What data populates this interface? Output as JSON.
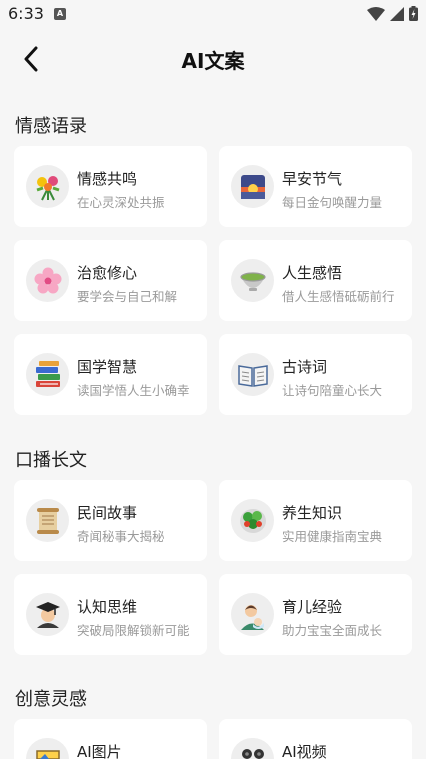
{
  "status": {
    "time": "6:33"
  },
  "header": {
    "title": "AI文案"
  },
  "sections": [
    {
      "title": "情感语录",
      "cards": [
        {
          "title": "情感共鸣",
          "subtitle": "在心灵深处共振",
          "icon": "flower-bouquet-icon"
        },
        {
          "title": "早安节气",
          "subtitle": "每日金句唤醒力量",
          "icon": "sunrise-icon"
        },
        {
          "title": "治愈修心",
          "subtitle": "要学会与自己和解",
          "icon": "cherry-blossom-icon"
        },
        {
          "title": "人生感悟",
          "subtitle": "借人生感悟砥砺前行",
          "icon": "tea-bowl-icon"
        },
        {
          "title": "国学智慧",
          "subtitle": "读国学悟人生小确幸",
          "icon": "books-icon"
        },
        {
          "title": "古诗词",
          "subtitle": "让诗句陪童心长大",
          "icon": "open-book-icon"
        }
      ]
    },
    {
      "title": "口播长文",
      "cards": [
        {
          "title": "民间故事",
          "subtitle": "奇闻秘事大揭秘",
          "icon": "scroll-icon"
        },
        {
          "title": "养生知识",
          "subtitle": "实用健康指南宝典",
          "icon": "salad-icon"
        },
        {
          "title": "认知思维",
          "subtitle": "突破局限解锁新可能",
          "icon": "graduate-icon"
        },
        {
          "title": "育儿经验",
          "subtitle": "助力宝宝全面成长",
          "icon": "parent-baby-icon"
        }
      ]
    },
    {
      "title": "创意灵感",
      "cards": [
        {
          "title": "AI图片",
          "subtitle": "",
          "icon": "picture-icon"
        },
        {
          "title": "AI视频",
          "subtitle": "",
          "icon": "video-camera-icon"
        }
      ]
    }
  ]
}
